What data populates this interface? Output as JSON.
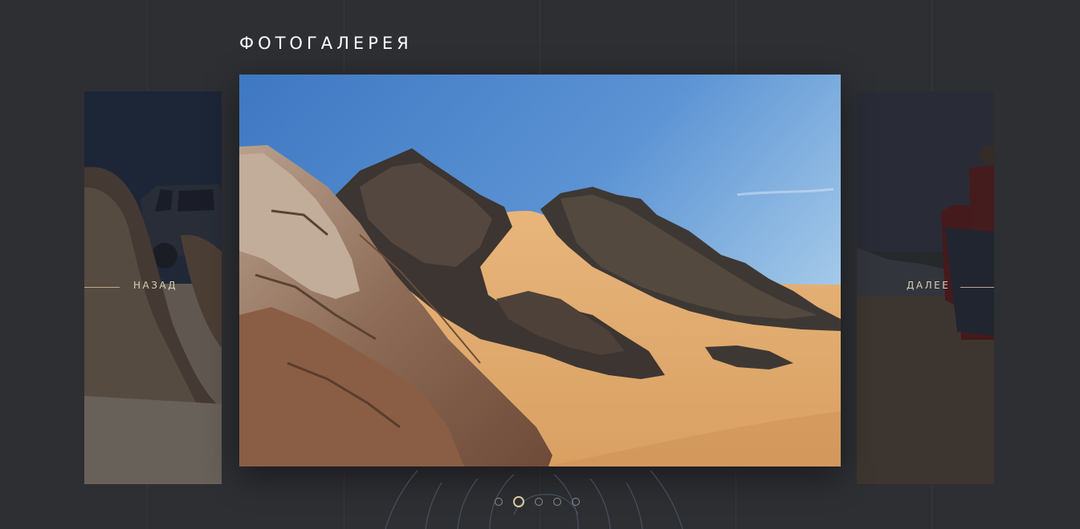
{
  "gallery": {
    "title": "ФОТОГАЛЕРЕЯ",
    "prev_label": "НАЗАД",
    "next_label": "ДАЛЕЕ",
    "slides_count": 5,
    "active_slide": 2
  },
  "colors": {
    "background": "#2e2f33",
    "accent": "#d8c89a",
    "sky": "#5a8fd0",
    "sand": "#e2ad6e"
  }
}
